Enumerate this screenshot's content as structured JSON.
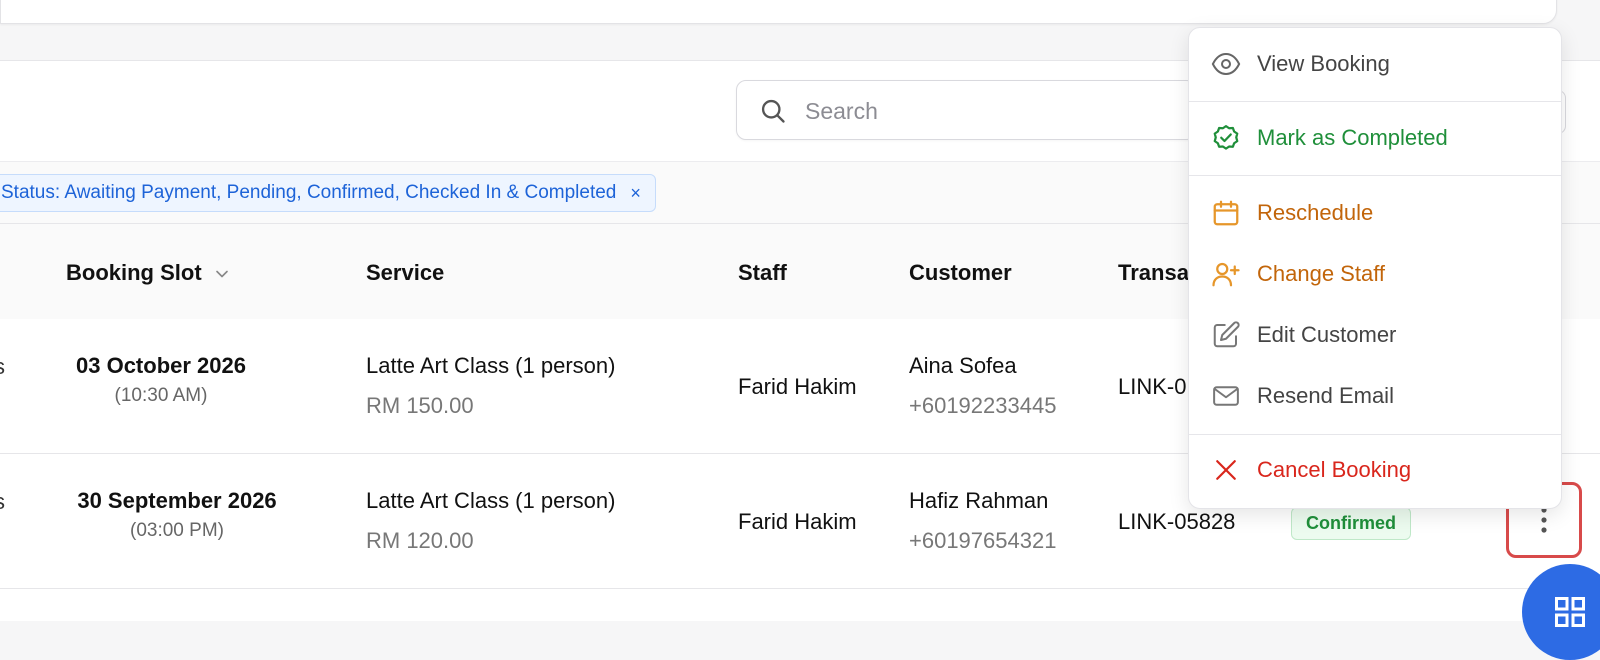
{
  "search": {
    "placeholder": "Search"
  },
  "filter": {
    "chip_label": "Status: Awaiting Payment, Pending, Confirmed, Checked In & Completed",
    "chip_close": "×"
  },
  "table": {
    "headers": {
      "booking_slot": "Booking Slot",
      "service": "Service",
      "staff": "Staff",
      "customer": "Customer",
      "transaction": "Transa"
    },
    "rows": [
      {
        "cut_text": "s",
        "date": "03 October 2026",
        "time": "(10:30 AM)",
        "service": "Latte Art Class (1 person)",
        "price": "RM 150.00",
        "staff": "Farid Hakim",
        "customer": "Aina Sofea",
        "phone": "+60192233445",
        "transaction": "LINK-0"
      },
      {
        "cut_text": "s",
        "date": "30 September 2026",
        "time": "(03:00 PM)",
        "service": "Latte Art Class (1 person)",
        "price": "RM 120.00",
        "staff": "Farid Hakim",
        "customer": "Hafiz Rahman",
        "phone": "+60197654321",
        "transaction": "LINK-05828",
        "status": "Confirmed"
      }
    ]
  },
  "menu": {
    "view": "View Booking",
    "complete": "Mark as Completed",
    "reschedule": "Reschedule",
    "change_staff": "Change Staff",
    "edit_customer": "Edit Customer",
    "resend_email": "Resend Email",
    "cancel": "Cancel Booking"
  },
  "colors": {
    "primary": "#2d6be4",
    "success": "#1f8f3a",
    "warning": "#c2650a",
    "danger": "#d9261c",
    "highlight": "#d84a4a"
  }
}
